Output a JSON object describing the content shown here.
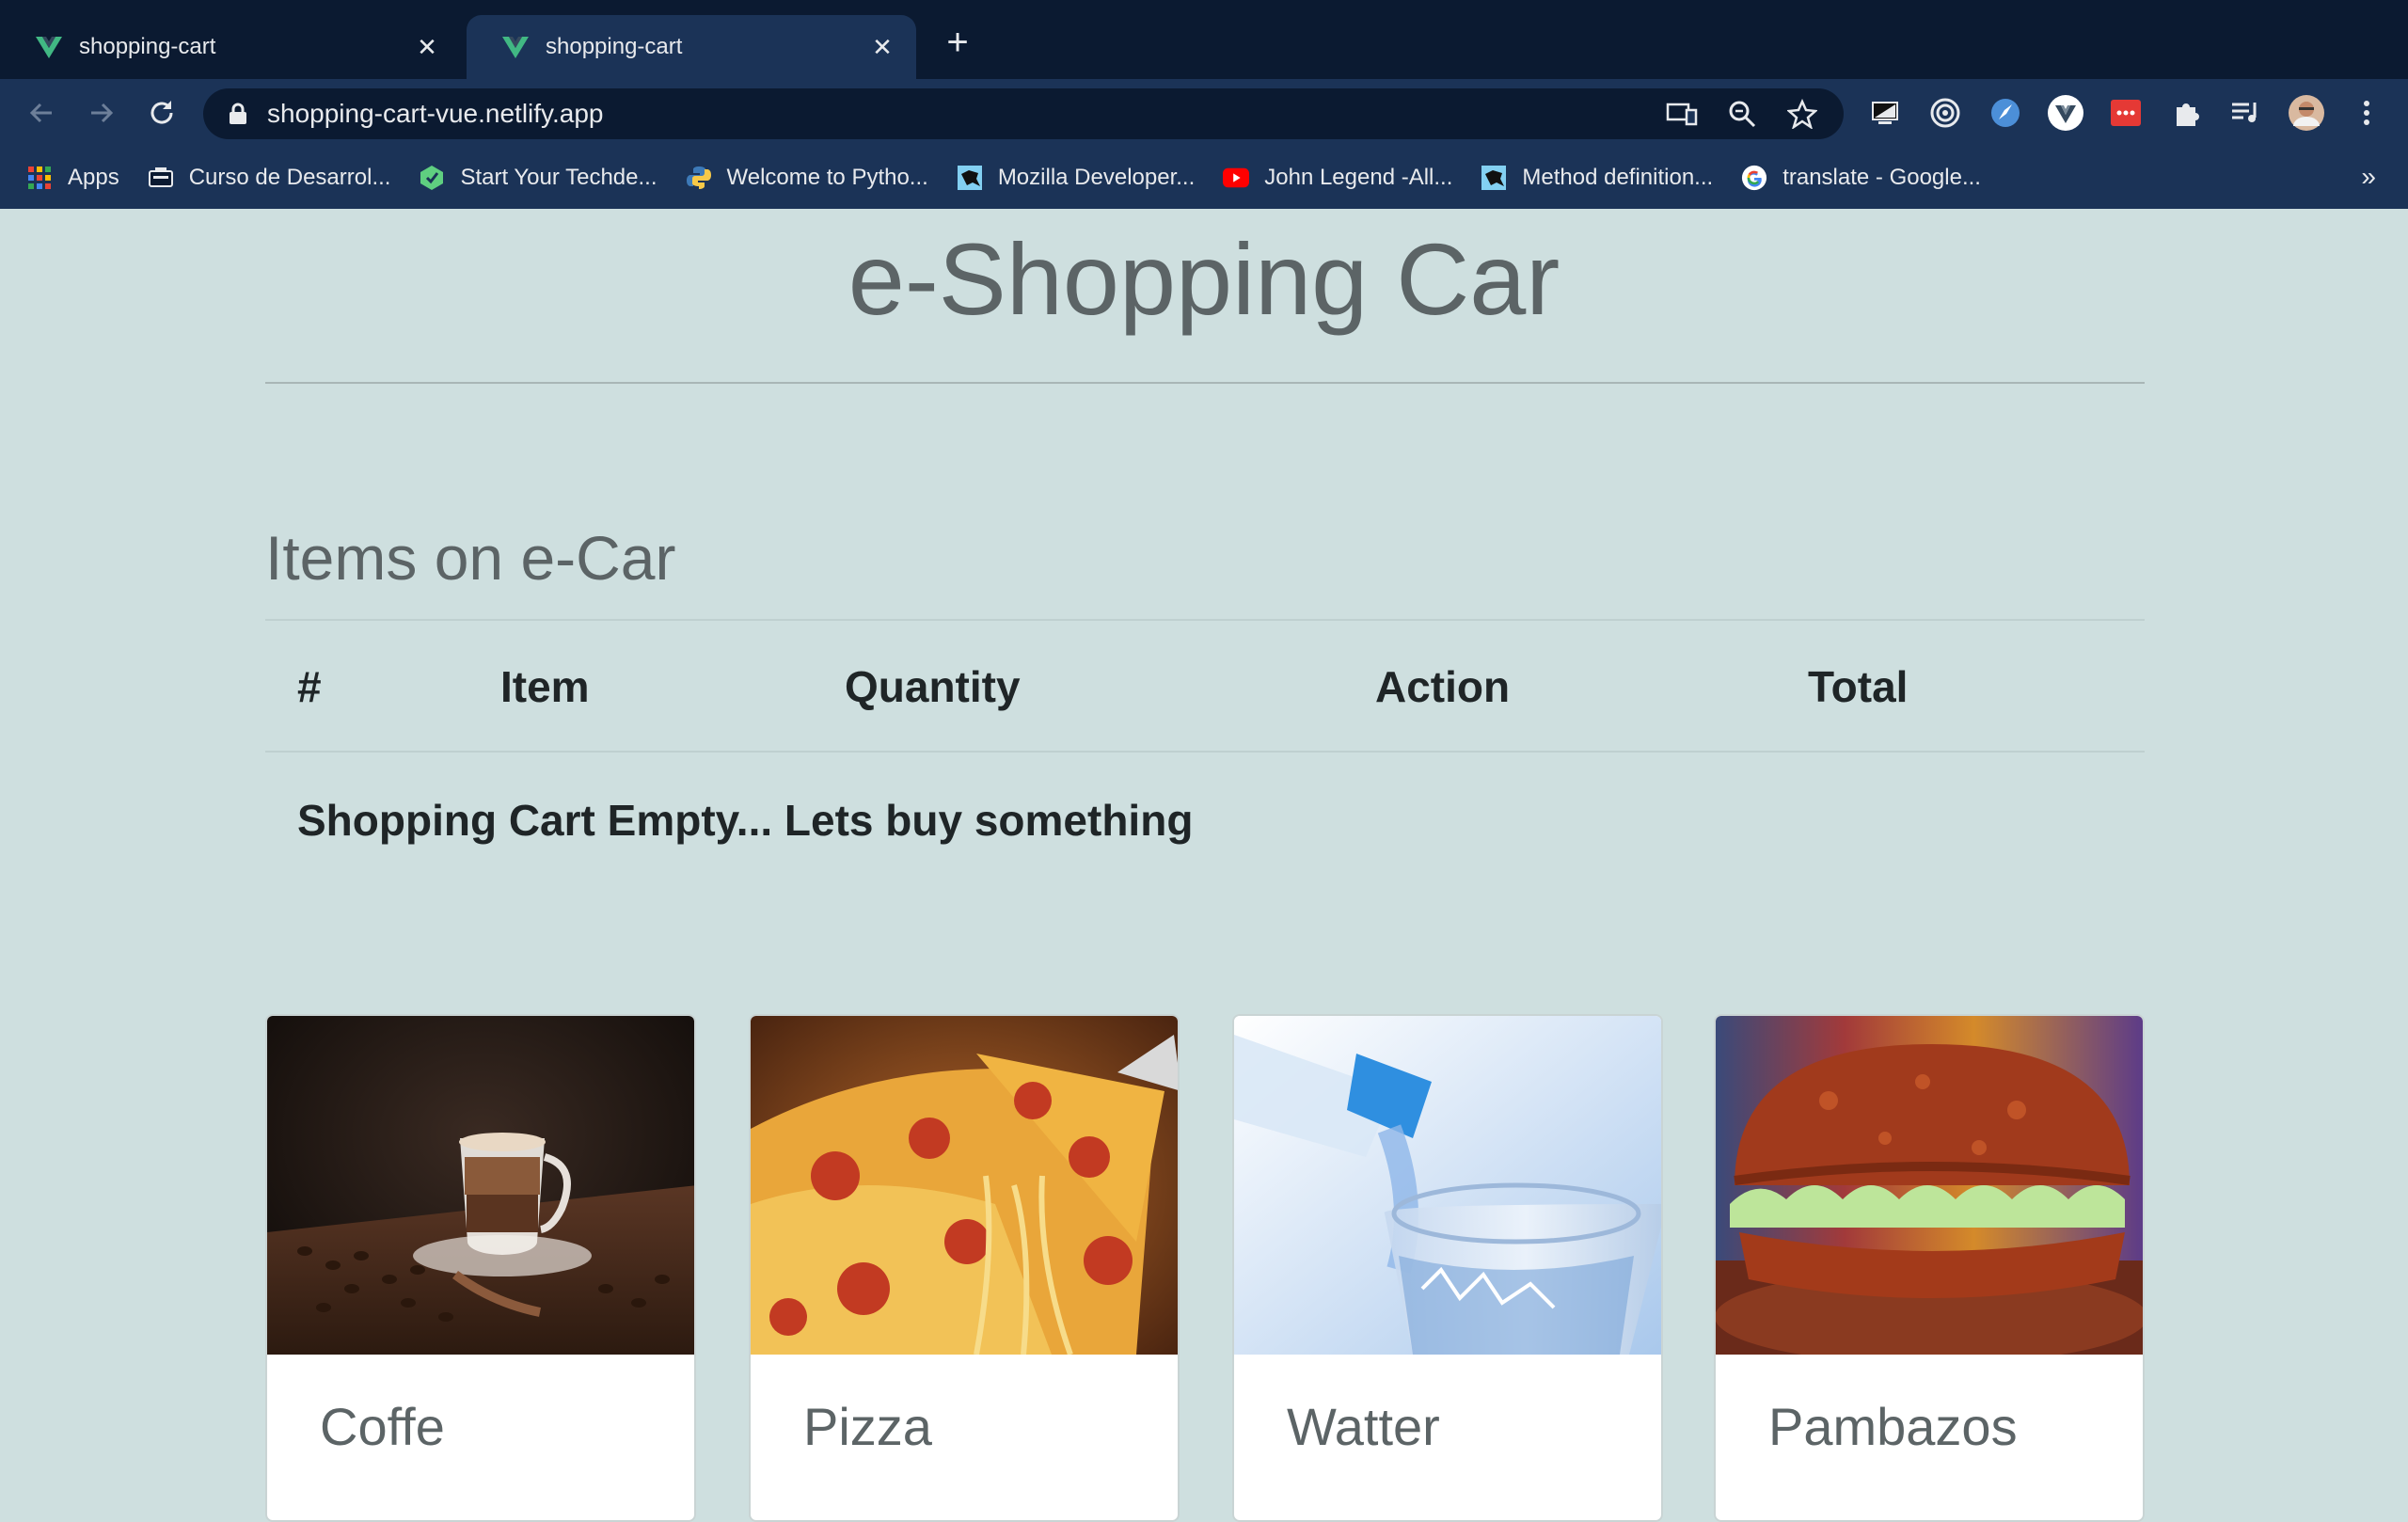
{
  "browser": {
    "tabs": [
      {
        "title": "shopping-cart",
        "active": false
      },
      {
        "title": "shopping-cart",
        "active": true
      }
    ],
    "url": "shopping-cart-vue.netlify.app",
    "bookmarks": [
      {
        "label": "Apps",
        "icon": "apps-grid-icon"
      },
      {
        "label": "Curso de Desarrol...",
        "icon": "course-icon"
      },
      {
        "label": "Start Your Techde...",
        "icon": "techdegree-icon"
      },
      {
        "label": "Welcome to Pytho...",
        "icon": "python-icon"
      },
      {
        "label": "Mozilla Developer...",
        "icon": "mdn-icon"
      },
      {
        "label": "John Legend -All...",
        "icon": "youtube-icon"
      },
      {
        "label": "Method definition...",
        "icon": "mdn-icon"
      },
      {
        "label": "translate - Google...",
        "icon": "google-icon"
      }
    ],
    "bookmarks_overflow": "»"
  },
  "page": {
    "title": "e-Shopping Car",
    "cart_title": "Items on e-Car",
    "columns": [
      "#",
      "Item",
      "Quantity",
      "Action",
      "Total"
    ],
    "empty_message": "Shopping Cart Empty... Lets buy something",
    "products": [
      {
        "name": "Coffe",
        "image": "coffee-photo"
      },
      {
        "name": "Pizza",
        "image": "pizza-photo"
      },
      {
        "name": "Watter",
        "image": "water-photo"
      },
      {
        "name": "Pambazos",
        "image": "pambazo-photo"
      }
    ]
  },
  "colors": {
    "background": "#cedfdf",
    "tabbar": "#0b1a31",
    "toolbar": "#1b3357",
    "heading": "#5c6466",
    "text": "#1f2527"
  }
}
